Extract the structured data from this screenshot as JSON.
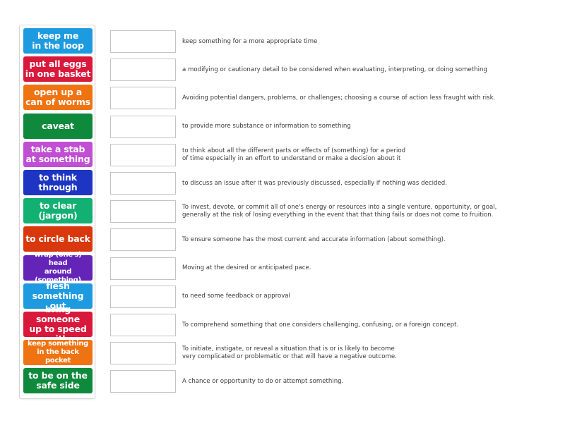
{
  "tiles": [
    {
      "label": "keep me\nin the loop",
      "color": "#1e9be0"
    },
    {
      "label": "put all eggs\nin one basket",
      "color": "#d9193c"
    },
    {
      "label": "open up a\ncan of worms",
      "color": "#f07312"
    },
    {
      "label": "caveat",
      "color": "#0f8a3c"
    },
    {
      "label": "take a stab\nat something",
      "color": "#c04fd3"
    },
    {
      "label": "to think\nthrough",
      "color": "#1d35c2"
    },
    {
      "label": "to clear\n(jargon)",
      "color": "#13b073"
    },
    {
      "label": "to circle back",
      "color": "#d8380c"
    },
    {
      "label": "wrap (one's) head\naround (something)",
      "color": "#6424b8",
      "small": true
    },
    {
      "label": "flesh\nsomething out",
      "color": "#1e9be0"
    },
    {
      "label": "bring someone\nup to speed with",
      "color": "#d9193c"
    },
    {
      "label": "keep something\nin the back pocket",
      "color": "#f07312",
      "small": true
    },
    {
      "label": "to be on the\nsafe side",
      "color": "#0f8a3c"
    }
  ],
  "rows": [
    {
      "answer": "",
      "description": "keep something for a more appropriate time"
    },
    {
      "answer": "",
      "description": "a modifying or cautionary detail to be considered when evaluating, interpreting, or doing something"
    },
    {
      "answer": "",
      "description": "Avoiding potential dangers, problems, or challenges; choosing a course of action less fraught with risk."
    },
    {
      "answer": "",
      "description": "to provide more substance or information to something"
    },
    {
      "answer": "",
      "description": "to think about all the different parts or effects of (something) for a period\nof time especially in an effort to understand or make a decision about it"
    },
    {
      "answer": "",
      "description": "to discuss an issue after it was previously discussed, especially if nothing was decided."
    },
    {
      "answer": "",
      "description": "To invest, devote, or commit all of one's energy or resources into a single venture, opportunity, or goal,\ngenerally at the risk of losing everything in the event that that thing fails or does not come to fruition."
    },
    {
      "answer": "",
      "description": "To ensure someone has the most current and accurate information (about something)."
    },
    {
      "answer": "",
      "description": "Moving at the desired or anticipated pace."
    },
    {
      "answer": "",
      "description": "to need some feedback or approval"
    },
    {
      "answer": "",
      "description": "To comprehend something that one considers challenging, confusing, or a foreign concept."
    },
    {
      "answer": "",
      "description": "To initiate, instigate, or reveal a situation that is or is likely to become\nvery complicated or problematic or that will have a negative outcome."
    },
    {
      "answer": "",
      "description": "A chance or opportunity to do or attempt something."
    }
  ]
}
